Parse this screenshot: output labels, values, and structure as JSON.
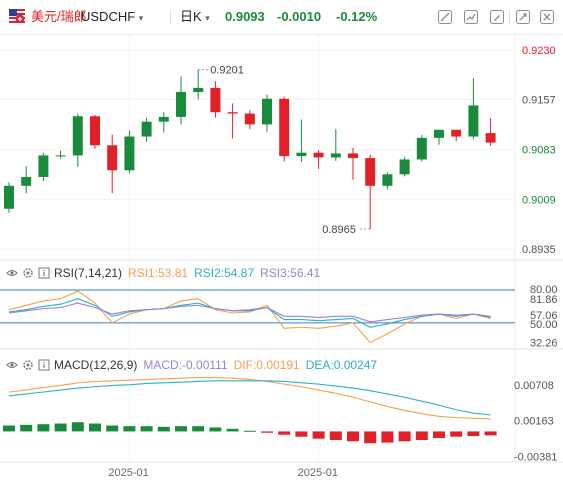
{
  "header": {
    "symbol_name": "美元/瑞郎",
    "symbol_code": "USDCHF",
    "dropdown_caret": "▾",
    "period": "日K",
    "price": "0.9093",
    "change": "-0.0010",
    "change_pct": "-0.12%",
    "tools": [
      "crosshair-icon",
      "draw-line-icon",
      "pencil-icon",
      "delete-icon",
      "expand-icon",
      "close-icon"
    ]
  },
  "rsi_header": {
    "name": "RSI(7,14,21)",
    "rsi1": "RSI1:53.81",
    "rsi2": "RSI2:54.87",
    "rsi3": "RSI3:56.41"
  },
  "macd_header": {
    "name": "MACD(12,26,9)",
    "macd": "MACD:-0.00111",
    "dif": "DIF:0.00191",
    "dea": "DEA:0.00247"
  },
  "colors": {
    "up": "#1a8a3c",
    "down": "#e0212a",
    "rsi1": "#f6a04d",
    "rsi2": "#2bb0c8",
    "rsi3": "#9b80d6",
    "ref_line": "#2f7fd0"
  },
  "chart_data": [
    {
      "type": "candlestick",
      "panel": "price",
      "yaxis_ticks": [
        "0.9230",
        "0.9157",
        "0.9083",
        "0.9009",
        "0.8935"
      ],
      "ylim": [
        0.8925,
        0.9242
      ],
      "price_labels": [
        {
          "text": "0.9201",
          "value": 0.9201,
          "index": 11
        },
        {
          "text": "0.8965",
          "value": 0.8965,
          "index": 21
        }
      ],
      "candles": [
        {
          "o": 0.8995,
          "h": 0.9034,
          "l": 0.8989,
          "c": 0.9029
        },
        {
          "o": 0.9029,
          "h": 0.9058,
          "l": 0.9018,
          "c": 0.9042
        },
        {
          "o": 0.9042,
          "h": 0.9078,
          "l": 0.9036,
          "c": 0.9074
        },
        {
          "o": 0.9074,
          "h": 0.9081,
          "l": 0.9069,
          "c": 0.9074
        },
        {
          "o": 0.9074,
          "h": 0.9136,
          "l": 0.9057,
          "c": 0.9132
        },
        {
          "o": 0.9132,
          "h": 0.9134,
          "l": 0.9084,
          "c": 0.9089
        },
        {
          "o": 0.9089,
          "h": 0.9105,
          "l": 0.9018,
          "c": 0.9052
        },
        {
          "o": 0.9052,
          "h": 0.9111,
          "l": 0.9048,
          "c": 0.9102
        },
        {
          "o": 0.9102,
          "h": 0.913,
          "l": 0.9094,
          "c": 0.9124
        },
        {
          "o": 0.9124,
          "h": 0.9138,
          "l": 0.9108,
          "c": 0.9131
        },
        {
          "o": 0.9131,
          "h": 0.9191,
          "l": 0.912,
          "c": 0.9168
        },
        {
          "o": 0.9168,
          "h": 0.9201,
          "l": 0.9157,
          "c": 0.9174
        },
        {
          "o": 0.9174,
          "h": 0.9184,
          "l": 0.913,
          "c": 0.9138
        },
        {
          "o": 0.9138,
          "h": 0.9151,
          "l": 0.9099,
          "c": 0.9136
        },
        {
          "o": 0.9136,
          "h": 0.9141,
          "l": 0.9113,
          "c": 0.912
        },
        {
          "o": 0.912,
          "h": 0.9164,
          "l": 0.9109,
          "c": 0.9158
        },
        {
          "o": 0.9158,
          "h": 0.9161,
          "l": 0.9065,
          "c": 0.9073
        },
        {
          "o": 0.9073,
          "h": 0.9127,
          "l": 0.9064,
          "c": 0.9078
        },
        {
          "o": 0.9078,
          "h": 0.9082,
          "l": 0.9054,
          "c": 0.9071
        },
        {
          "o": 0.9071,
          "h": 0.9113,
          "l": 0.9066,
          "c": 0.9077
        },
        {
          "o": 0.9077,
          "h": 0.9085,
          "l": 0.9038,
          "c": 0.907
        },
        {
          "o": 0.907,
          "h": 0.9075,
          "l": 0.8965,
          "c": 0.9029
        },
        {
          "o": 0.9029,
          "h": 0.9049,
          "l": 0.9024,
          "c": 0.9046
        },
        {
          "o": 0.9046,
          "h": 0.9072,
          "l": 0.9043,
          "c": 0.9068
        },
        {
          "o": 0.9068,
          "h": 0.9104,
          "l": 0.9065,
          "c": 0.91
        },
        {
          "o": 0.91,
          "h": 0.9112,
          "l": 0.909,
          "c": 0.9112
        },
        {
          "o": 0.9112,
          "h": 0.9111,
          "l": 0.9095,
          "c": 0.9102
        },
        {
          "o": 0.9102,
          "h": 0.9189,
          "l": 0.9098,
          "c": 0.9148
        },
        {
          "o": 0.9107,
          "h": 0.9129,
          "l": 0.9088,
          "c": 0.9093
        }
      ]
    },
    {
      "type": "line",
      "panel": "rsi",
      "yaxis_ticks": [
        "80.00",
        "81.86",
        "57.06",
        "50.00",
        "32.26"
      ],
      "ref_lines": [
        80,
        50
      ],
      "ylim": [
        28,
        90
      ],
      "series": [
        {
          "name": "RSI1",
          "values": [
            62,
            66,
            70,
            72,
            79,
            68,
            50,
            58,
            62,
            63,
            70,
            72,
            62,
            59,
            60,
            66,
            45,
            46,
            45,
            47,
            50,
            32,
            40,
            49,
            56,
            58,
            54,
            58,
            54
          ]
        },
        {
          "name": "RSI2",
          "values": [
            60,
            62,
            65,
            67,
            72,
            66,
            56,
            60,
            62,
            63,
            66,
            68,
            63,
            61,
            61,
            64,
            53,
            53,
            52,
            53,
            54,
            46,
            49,
            53,
            56,
            58,
            56,
            58,
            55
          ]
        },
        {
          "name": "RSI3",
          "values": [
            59,
            61,
            63,
            64,
            68,
            64,
            58,
            61,
            62,
            63,
            65,
            66,
            63,
            61,
            62,
            64,
            56,
            56,
            55,
            56,
            56,
            51,
            53,
            55,
            57,
            58,
            57,
            58,
            56
          ]
        }
      ]
    },
    {
      "type": "bar+line",
      "panel": "macd",
      "yaxis_ticks": [
        "0.00708",
        "0.00163",
        "-0.00381"
      ],
      "ylim": [
        -0.0045,
        0.0095
      ],
      "histogram": [
        0.0009,
        0.001,
        0.0011,
        0.0012,
        0.0014,
        0.0012,
        0.0009,
        0.0008,
        0.0008,
        0.0007,
        0.0008,
        0.0008,
        0.0006,
        0.0004,
        0.0001,
        -0.0002,
        -0.0005,
        -0.0008,
        -0.0011,
        -0.0013,
        -0.0015,
        -0.0018,
        -0.0017,
        -0.0015,
        -0.0013,
        -0.001,
        -0.0008,
        -0.0007,
        -0.0006
      ],
      "series": [
        {
          "name": "DIF",
          "values": [
            0.006,
            0.0063,
            0.0067,
            0.007,
            0.0074,
            0.0076,
            0.0077,
            0.0078,
            0.0079,
            0.008,
            0.0081,
            0.0082,
            0.0082,
            0.0081,
            0.0079,
            0.0076,
            0.0072,
            0.0068,
            0.0063,
            0.0058,
            0.0052,
            0.0045,
            0.0038,
            0.0032,
            0.0027,
            0.0023,
            0.0021,
            0.002,
            0.0019
          ]
        },
        {
          "name": "DEA",
          "values": [
            0.0054,
            0.0057,
            0.006,
            0.0063,
            0.0066,
            0.0068,
            0.007,
            0.0071,
            0.0073,
            0.0074,
            0.0075,
            0.0076,
            0.0077,
            0.0077,
            0.0077,
            0.0077,
            0.0076,
            0.0074,
            0.0072,
            0.0069,
            0.0066,
            0.0062,
            0.0057,
            0.0052,
            0.0046,
            0.004,
            0.0033,
            0.0028,
            0.0025
          ]
        }
      ]
    }
  ],
  "xaxis_labels": [
    {
      "text": "2025-01",
      "index": 7
    },
    {
      "text": "2025-01",
      "index": 18
    }
  ]
}
